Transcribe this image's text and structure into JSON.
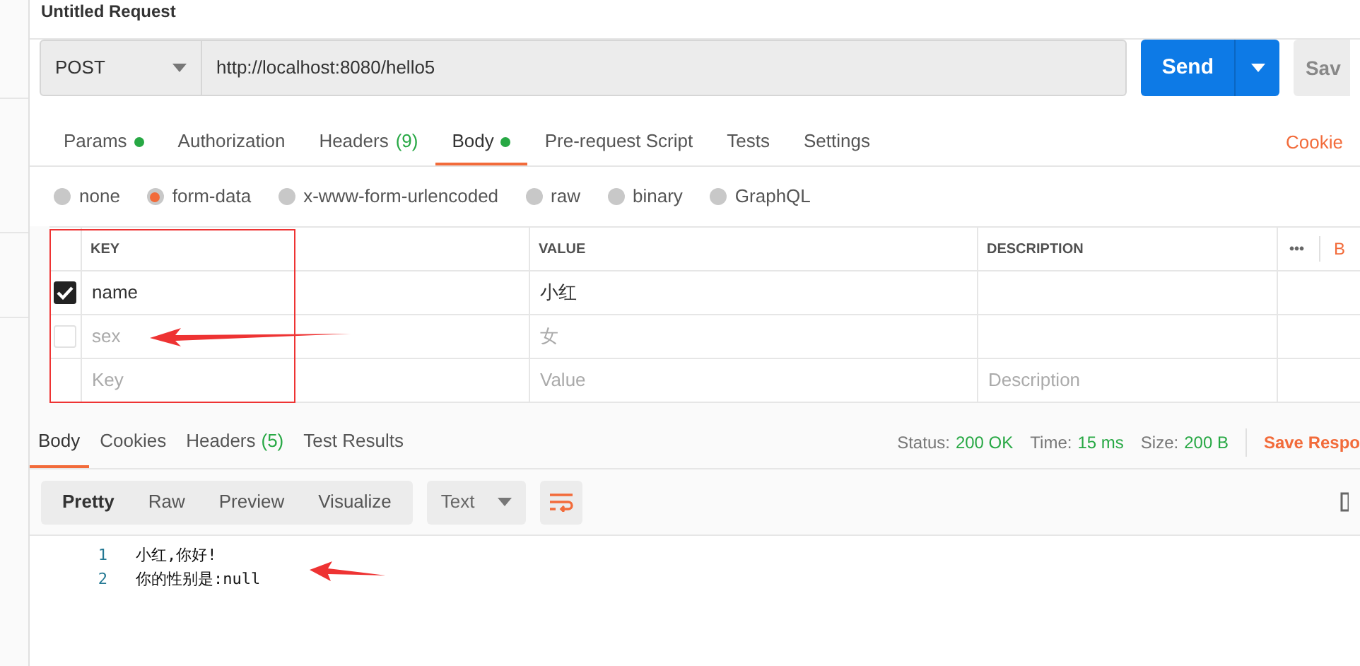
{
  "title": "Untitled Request",
  "request": {
    "method": "POST",
    "url": "http://localhost:8080/hello5",
    "send": "Send",
    "save": "Sav"
  },
  "tabs": [
    {
      "label": "Params",
      "dot": true,
      "selected": false
    },
    {
      "label": "Authorization",
      "dot": false,
      "selected": false
    },
    {
      "label": "Headers",
      "count": "(9)",
      "dot": false,
      "selected": false
    },
    {
      "label": "Body",
      "dot": true,
      "selected": true
    },
    {
      "label": "Pre-request Script",
      "dot": false,
      "selected": false
    },
    {
      "label": "Tests",
      "dot": false,
      "selected": false
    },
    {
      "label": "Settings",
      "dot": false,
      "selected": false
    }
  ],
  "cookies_link": "Cookie",
  "body_types": [
    {
      "label": "none",
      "selected": false
    },
    {
      "label": "form-data",
      "selected": true
    },
    {
      "label": "x-www-form-urlencoded",
      "selected": false
    },
    {
      "label": "raw",
      "selected": false
    },
    {
      "label": "binary",
      "selected": false
    },
    {
      "label": "GraphQL",
      "selected": false
    }
  ],
  "table": {
    "columns": [
      "KEY",
      "VALUE",
      "DESCRIPTION"
    ],
    "more": "•••",
    "bulk_edit": "B",
    "rows": [
      {
        "checked": true,
        "key": "name",
        "value": "小红"
      },
      {
        "checked": false,
        "key": "sex",
        "value": "女"
      }
    ],
    "new_row": {
      "key": {
        "placeholder": "Key"
      },
      "value": {
        "placeholder": "Value"
      },
      "description": {
        "placeholder": "Description"
      }
    }
  },
  "response": {
    "tabs": [
      {
        "label": "Body",
        "selected": true
      },
      {
        "label": "Cookies",
        "selected": false
      },
      {
        "label": "Headers",
        "count": "(5)",
        "selected": false
      },
      {
        "label": "Test Results",
        "selected": false
      }
    ],
    "stats": [
      {
        "label": "Status:",
        "value": "200 OK"
      },
      {
        "label": "Time:",
        "value": "15 ms"
      },
      {
        "label": "Size:",
        "value": "200 B"
      }
    ],
    "save": "Save Respo",
    "views": [
      {
        "label": "Pretty",
        "selected": true
      },
      {
        "label": "Raw",
        "selected": false
      },
      {
        "label": "Preview",
        "selected": false
      },
      {
        "label": "Visualize",
        "selected": false
      }
    ],
    "format": "Text",
    "lines": [
      {
        "number": "1",
        "text": "小红,你好!"
      },
      {
        "number": "2",
        "text": "你的性别是:null"
      }
    ]
  }
}
